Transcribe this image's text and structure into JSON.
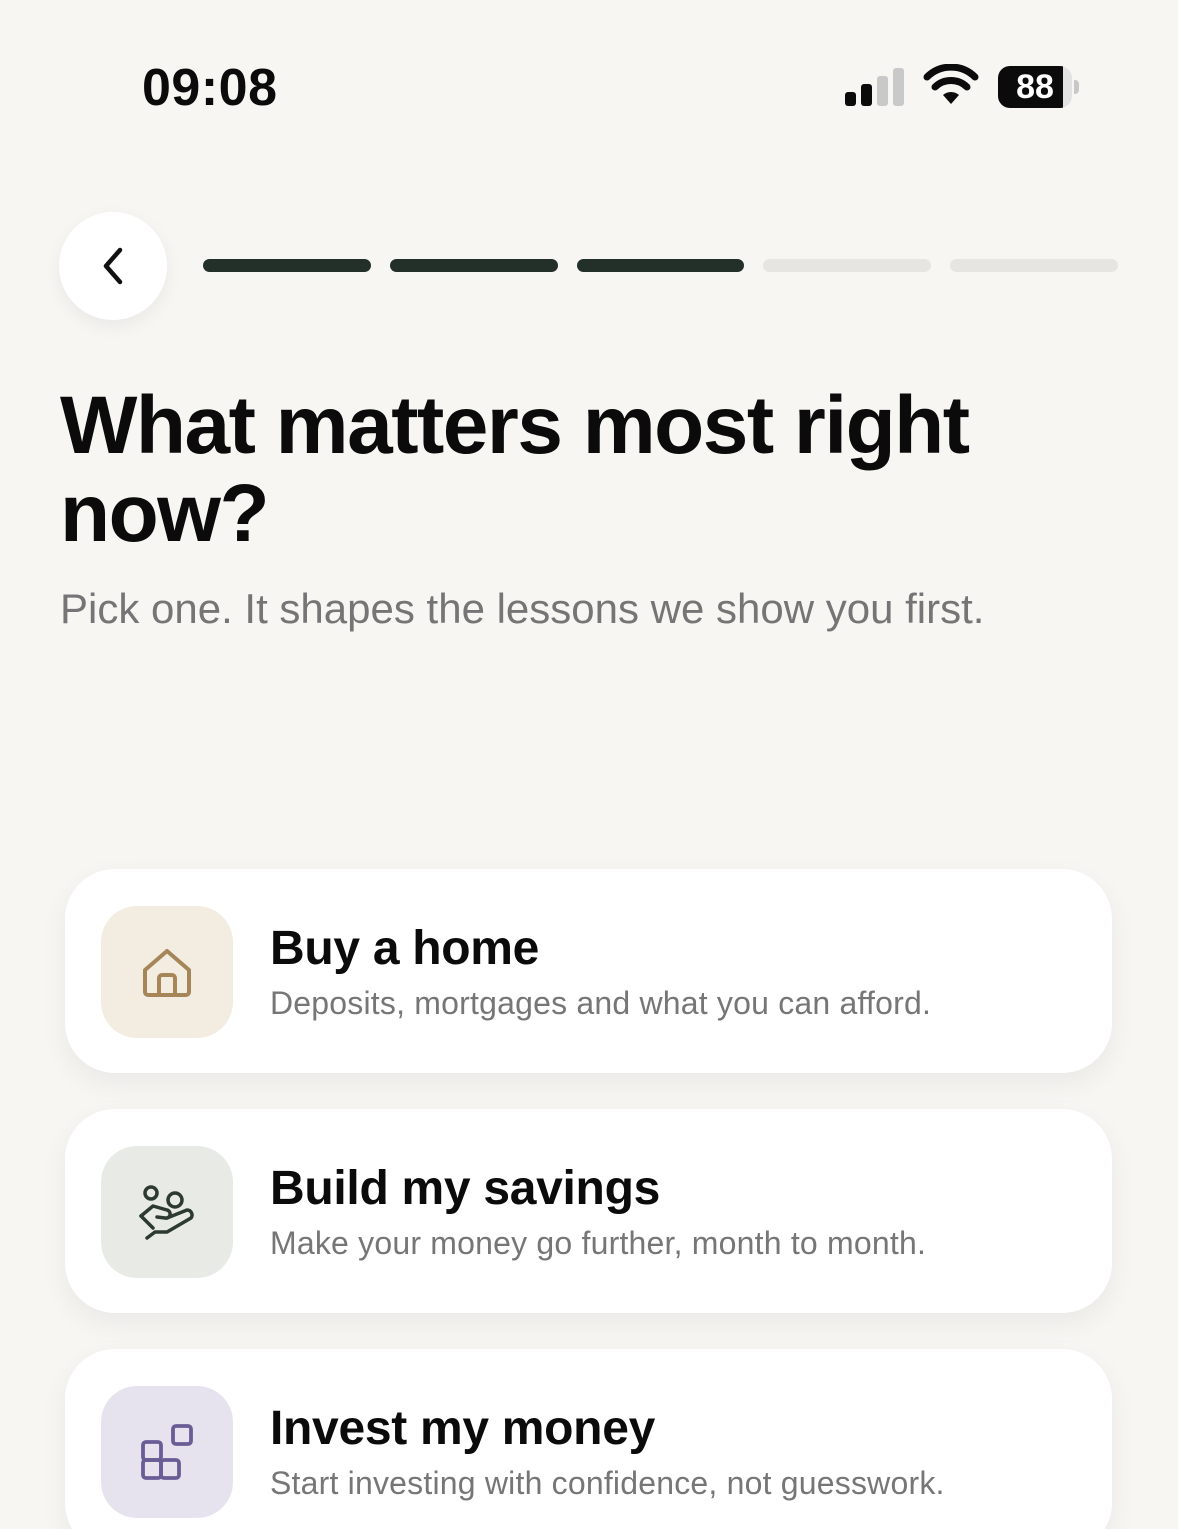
{
  "status_bar": {
    "time": "09:08",
    "battery_percent": "88",
    "signal_bars_active": 2,
    "signal_bars_total": 4
  },
  "nav": {
    "back_icon": "chevron-left-icon",
    "progress": {
      "total_steps": 5,
      "completed_steps": 3
    }
  },
  "heading": {
    "title": "What matters most right now?",
    "subtitle": "Pick one. It shapes the lessons we show you first."
  },
  "options": [
    {
      "title": "Buy a home",
      "description": "Deposits, mortgages and what you can afford.",
      "icon": "house-icon",
      "tile_color": "#f3ede1",
      "icon_color": "#a68659"
    },
    {
      "title": "Build my savings",
      "description": "Make your money go further, month to month.",
      "icon": "hand-coins-icon",
      "tile_color": "#e8ebe5",
      "icon_color": "#2c3a30"
    },
    {
      "title": "Invest my money",
      "description": "Start investing with confidence, not guesswork.",
      "icon": "blocks-icon",
      "tile_color": "#e6e3ee",
      "icon_color": "#6a5d96"
    }
  ],
  "colors": {
    "background": "#f7f6f3",
    "progress_done": "#233029",
    "progress_todo": "#e6e5e2"
  }
}
